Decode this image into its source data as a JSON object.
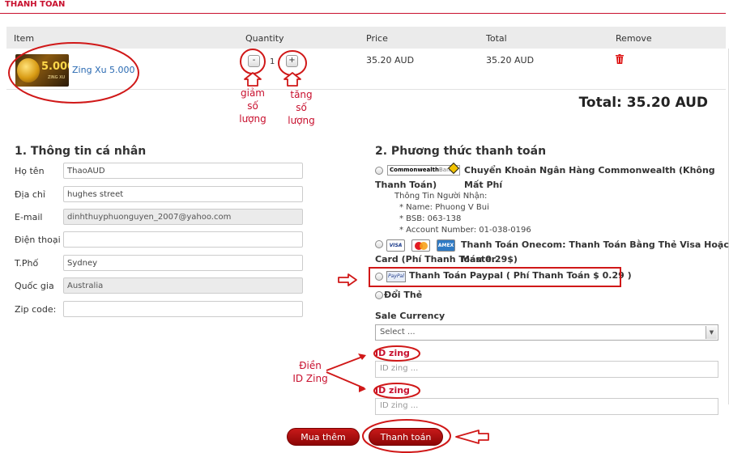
{
  "page_title": "THANH TOÁN",
  "cart": {
    "columns": {
      "item": "Item",
      "quantity": "Quantity",
      "price": "Price",
      "total": "Total",
      "remove": "Remove"
    },
    "product": {
      "image_text": "5.000",
      "image_subtext": "ZING XU",
      "name": "Zing Xu 5.000",
      "quantity": "1",
      "minus": "-",
      "plus": "+",
      "price": "35.20 AUD",
      "total": "35.20 AUD",
      "remove_icon": "trash-icon"
    },
    "grand_total": "Total: 35.20 AUD"
  },
  "personal": {
    "title": "1. Thông tin cá nhân",
    "fields": [
      {
        "label": "Họ tên",
        "value": "ThaoAUD",
        "readonly": false
      },
      {
        "label": "Địa chỉ",
        "value": "hughes street",
        "readonly": false
      },
      {
        "label": "E-mail",
        "value": "dinhthuyphuonguyen_2007@yahoo.com",
        "readonly": true
      },
      {
        "label": "Điện thoại",
        "value": "",
        "readonly": false
      },
      {
        "label": "T.Phố",
        "value": "Sydney",
        "readonly": false
      },
      {
        "label": "Quốc gia",
        "value": "Australia",
        "readonly": true
      },
      {
        "label": "Zip code:",
        "value": "",
        "readonly": false
      }
    ]
  },
  "payment": {
    "title": "2. Phương thức thanh toán",
    "bank": {
      "logo_bold": "Commonwealth",
      "logo_rest": "Bank",
      "line1": "Chuyển Khoản Ngân Hàng Commonwealth (Không Mất Phí",
      "line2": "Thanh Toán)",
      "receiver_heading": "Thông Tin Người Nhận:",
      "receiver_name": "* Name: Phuong V Bui",
      "receiver_bsb": "* BSB: 063-138",
      "receiver_account": "* Account Number: 01-038-0196"
    },
    "cards": {
      "visa": "VISA",
      "amex": "AMEX",
      "line1": "Thanh Toán Onecom: Thanh Toán Bằng Thẻ Visa Hoặc Master",
      "line2": "Card (Phí Thanh Toán 0.29$)"
    },
    "paypal": {
      "logo": "PayPal",
      "text": "Thanh Toán Paypal ( Phí Thanh Toán $ 0.29 )"
    },
    "exchange": "Đổi Thẻ",
    "sale_currency_label": "Sale Currency",
    "sale_currency_value": "Select ...",
    "id_label_1": "ID zing",
    "id_placeholder_1": "ID zing ...",
    "id_label_2": "ID zing",
    "id_placeholder_2": "ID zing ..."
  },
  "buttons": {
    "buy_more": "Mua thêm",
    "checkout": "Thanh toán"
  },
  "annotations": {
    "decrease_1": "giảm",
    "decrease_2": "số",
    "decrease_3": "lượng",
    "increase_1": "tăng",
    "increase_2": "số",
    "increase_3": "lượng",
    "fill_1": "Điền",
    "fill_2": "ID Zing"
  },
  "colors": {
    "accent": "#c8102e",
    "link": "#2a6ab2",
    "button": "#a00c0c"
  }
}
